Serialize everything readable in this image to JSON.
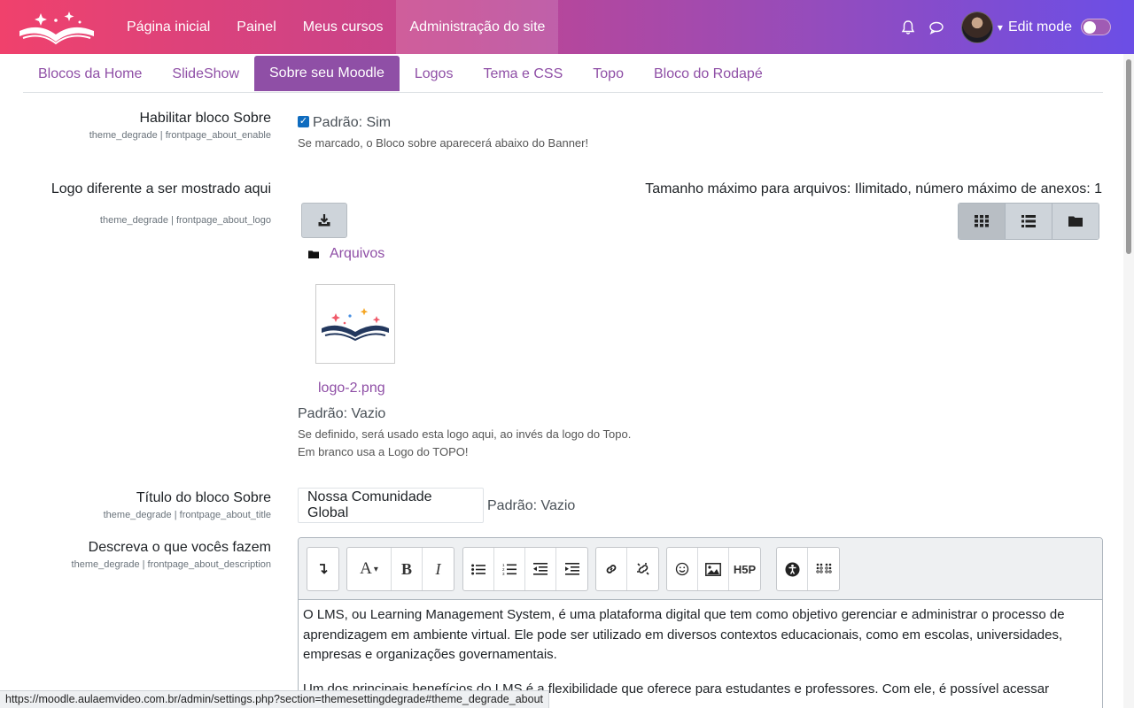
{
  "navbar": {
    "items": [
      "Página inicial",
      "Painel",
      "Meus cursos",
      "Administração do site"
    ],
    "active_index": 3,
    "edit_mode_label": "Edit mode",
    "icons": [
      "bell-icon",
      "chat-icon"
    ]
  },
  "tabs": {
    "items": [
      "Blocos da Home",
      "SlideShow",
      "Sobre seu Moodle",
      "Logos",
      "Tema e CSS",
      "Topo",
      "Bloco do Rodapé"
    ],
    "active_index": 2
  },
  "settings": {
    "enable": {
      "label": "Habilitar bloco Sobre",
      "key": "theme_degrade | frontpage_about_enable",
      "checked": true,
      "default": "Padrão: Sim",
      "description": "Se marcado, o Bloco sobre aparecerá abaixo do Banner!"
    },
    "logo": {
      "label": "Logo diferente a ser mostrado aqui",
      "key": "theme_degrade | frontpage_about_logo",
      "limits": "Tamanho máximo para arquivos: Ilimitado, número máximo de anexos: 1",
      "folder_label": "Arquivos",
      "file_name": "logo-2.png",
      "default": "Padrão: Vazio",
      "description_1": "Se definido, será usado esta logo aqui, ao invés da logo do Topo.",
      "description_2": "Em branco usa a Logo do TOPO!"
    },
    "title": {
      "label": "Título do bloco Sobre",
      "key": "theme_degrade | frontpage_about_title",
      "value": "Nossa Comunidade Global",
      "default": "Padrão: Vazio"
    },
    "description": {
      "label": "Descreva o que vocês fazem",
      "key": "theme_degrade | frontpage_about_description",
      "paragraph_1": "O LMS, ou Learning Management System, é uma plataforma digital que tem como objetivo gerenciar e administrar o processo de aprendizagem em ambiente virtual. Ele pode ser utilizado em diversos contextos educacionais, como em escolas, universidades, empresas e organizações governamentais.",
      "paragraph_2": "Um dos principais benefícios do LMS é a flexibilidade que oferece para estudantes e professores. Com ele, é possível acessar"
    }
  },
  "status_url": "https://moodle.aulaemvideo.com.br/admin/settings.php?section=themesettingdegrade#theme_degrade_about",
  "colors": {
    "accent": "#8f4fa6",
    "nav_start": "#f0416c",
    "nav_end": "#6b4ee6"
  }
}
